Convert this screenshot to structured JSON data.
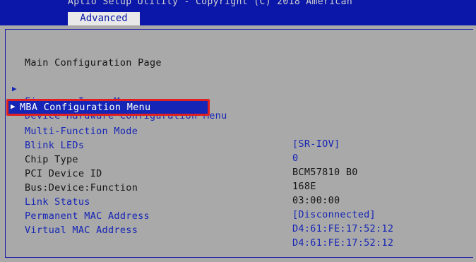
{
  "header": {
    "title": "Aptio Setup Utility - Copyright (C) 2018 American",
    "tab_label": "Advanced"
  },
  "page_title": "Main Configuration Page",
  "menu_links": [
    {
      "label": "Firmware Image Menu"
    },
    {
      "label": "Device Hardware Configuration Menu"
    },
    {
      "label": "MBA Configuration Menu",
      "selected": true
    }
  ],
  "settings": [
    {
      "label": "Multi-Function Mode",
      "value": "[SR-IOV]"
    },
    {
      "label": "Blink LEDs",
      "value": "0"
    },
    {
      "label": "Chip Type",
      "value": "BCM57810 B0"
    },
    {
      "label": "PCI Device ID",
      "value": "168E"
    },
    {
      "label": "Bus:Device:Function",
      "value": "03:00:00"
    },
    {
      "label": "Link Status",
      "value": "[Disconnected]"
    },
    {
      "label": "Permanent MAC Address",
      "value": "D4:61:FE:17:52:12"
    },
    {
      "label": "Virtual MAC Address",
      "value": "D4:61:FE:17:52:12"
    }
  ],
  "icons": {
    "menu_arrow": "triangle-right-icon"
  },
  "colors": {
    "header_bg": "#0a17a8",
    "body_bg": "#a9a9a9",
    "link_text": "#1525b5",
    "static_text": "#141414",
    "highlight_border": "#e02020"
  }
}
